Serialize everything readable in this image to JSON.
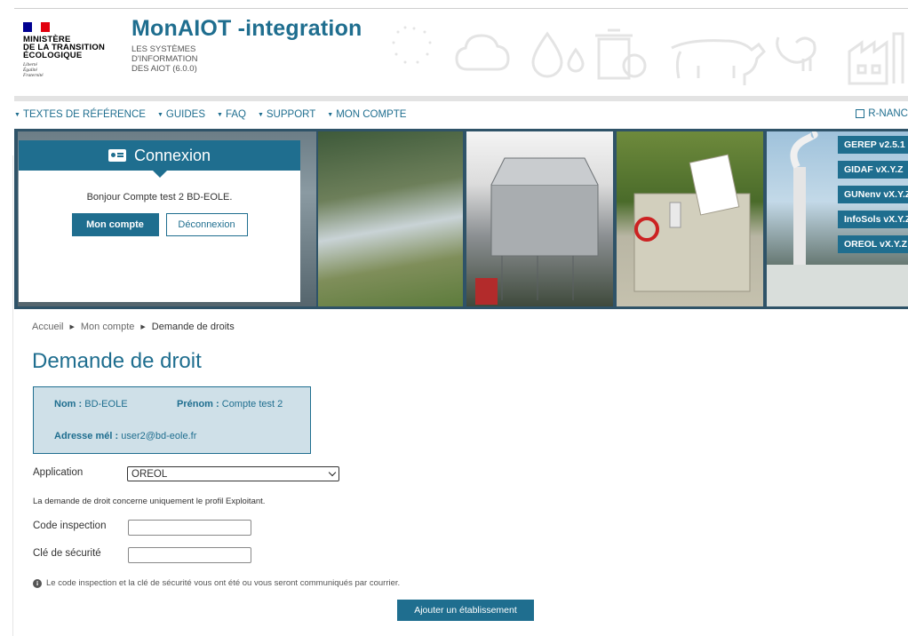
{
  "logo": {
    "ministry_lines": [
      "MINISTÈRE",
      "DE LA TRANSITION",
      "ÉCOLOGIQUE"
    ],
    "devise_lines": [
      "Liberté",
      "Égalité",
      "Fraternité"
    ]
  },
  "app": {
    "title": "MonAIOT -integration",
    "subtitle_lines": [
      "LES SYSTÈMES",
      "D'INFORMATION",
      "DES AIOT (6.0.0)"
    ]
  },
  "nav": {
    "items": [
      "TEXTES DE RÉFÉRENCE",
      "GUIDES",
      "FAQ",
      "SUPPORT",
      "MON COMPTE"
    ],
    "right_link": "R-NANC"
  },
  "login": {
    "title": "Connexion",
    "greeting": "Bonjour Compte test 2 BD-EOLE.",
    "account_button": "Mon compte",
    "logout_button": "Déconnexion"
  },
  "app_tabs": [
    "GEREP v2.5.1",
    "GIDAF vX.Y.Z",
    "GUNenv vX.Y.Z",
    "InfoSols vX.Y.Z",
    "OREOL vX.Y.Z"
  ],
  "breadcrumb": [
    "Accueil",
    "Mon compte",
    "Demande de droits"
  ],
  "page_title": "Demande de droit",
  "user_info": {
    "nom_label": "Nom :",
    "nom_value": "BD-EOLE",
    "prenom_label": "Prénom :",
    "prenom_value": "Compte test 2",
    "email_label": "Adresse mél :",
    "email_value": "user2@bd-eole.fr"
  },
  "form": {
    "application_label": "Application",
    "application_selected": "OREOL",
    "profile_note": "La demande de droit concerne uniquement le profil Exploitant.",
    "code_label": "Code inspection",
    "code_value": "",
    "key_label": "Clé de sécurité",
    "key_value": "",
    "hint": "Le code inspection et la clé de sécurité vous ont été ou vous seront communiqués par courrier.",
    "submit": "Ajouter un établissement"
  },
  "colors": {
    "primary": "#1f6e8f",
    "info_bg": "#cfe0e8",
    "banner_bg": "#2f5368"
  },
  "icons": [
    "external-link-icon",
    "id-card-icon",
    "info-icon",
    "chevron-down-icon",
    "caret-down-icon"
  ]
}
